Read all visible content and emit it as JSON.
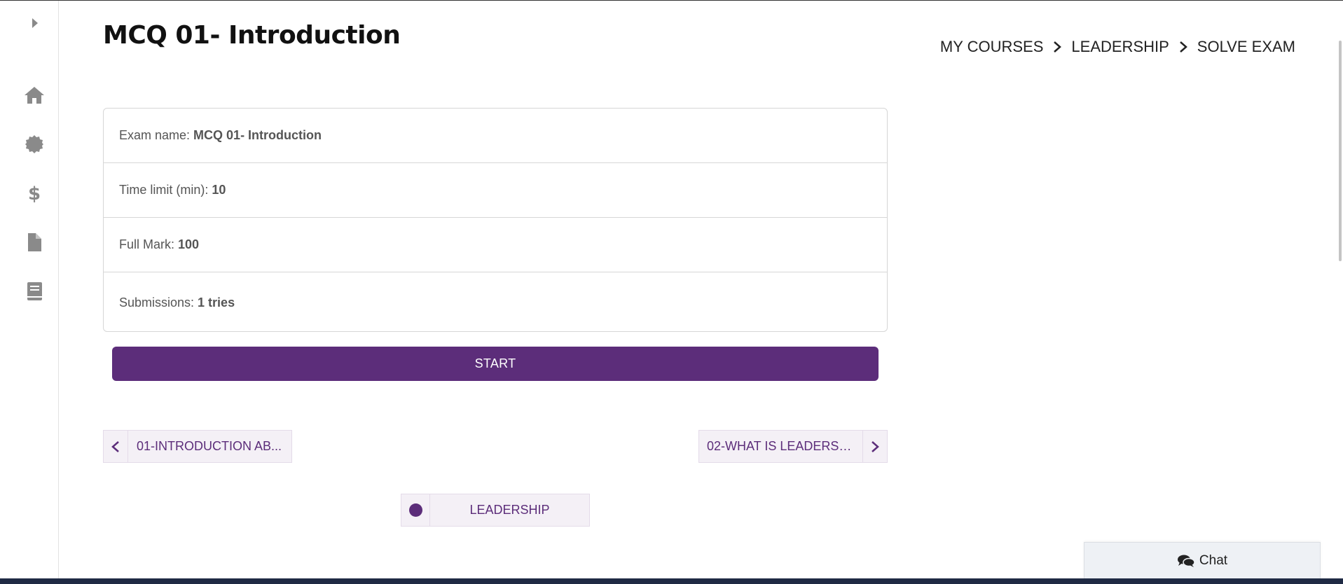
{
  "header": {
    "title": "MCQ 01- Introduction",
    "breadcrumb": [
      "MY COURSES",
      "LEADERSHIP",
      "SOLVE EXAM"
    ]
  },
  "sidebar": {
    "toggle_icon": "caret-right-icon",
    "items": [
      {
        "icon": "home-icon"
      },
      {
        "icon": "badge-icon"
      },
      {
        "icon": "dollar-icon"
      },
      {
        "icon": "file-icon"
      },
      {
        "icon": "book-icon"
      }
    ]
  },
  "exam": {
    "rows": [
      {
        "label": "Exam name:",
        "value": "MCQ 01- Introduction"
      },
      {
        "label": "Time limit (min):",
        "value": "10"
      },
      {
        "label": "Full Mark:",
        "value": "100"
      },
      {
        "label": "Submissions:",
        "value": "1 tries"
      }
    ],
    "start_label": "START"
  },
  "navigation": {
    "prev_label": "01-INTRODUCTION AB...",
    "next_label": "02-WHAT IS LEADERSH...",
    "course_label": "LEADERSHIP"
  },
  "chat": {
    "label": "Chat"
  },
  "colors": {
    "accent": "#5c2d7a",
    "nav_bg": "#f4f0f6",
    "icon_gray": "#8a8a8a"
  }
}
